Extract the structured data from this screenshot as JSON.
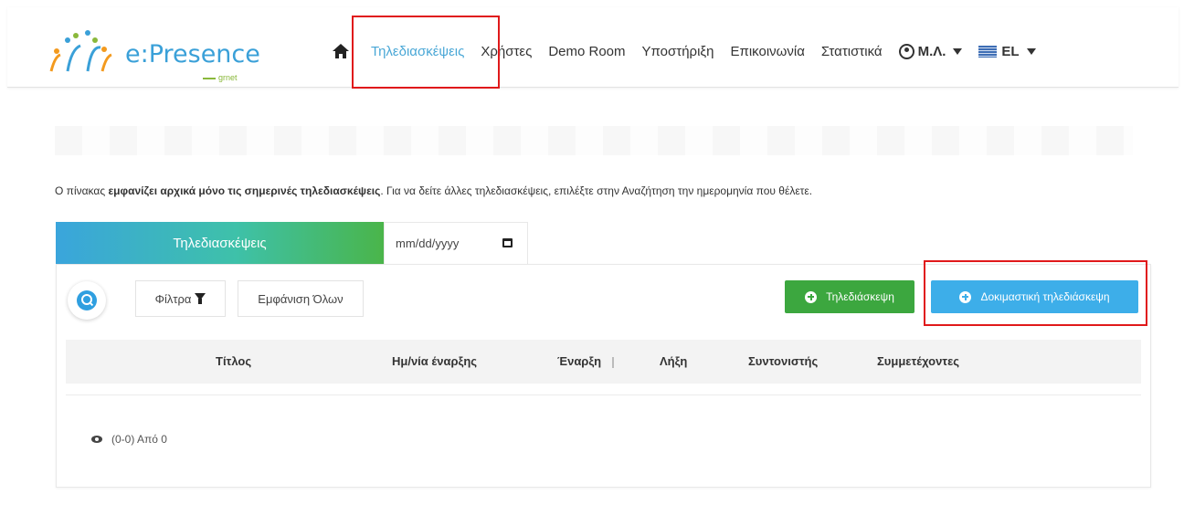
{
  "brand": {
    "name": "e:Presence",
    "sub": "grnet"
  },
  "nav": {
    "items": [
      "Τηλεδιασκέψεις",
      "Χρήστες",
      "Demo Room",
      "Υποστήριξη",
      "Επικοινωνία",
      "Στατιστικά"
    ],
    "user": "Μ.Λ.",
    "lang": "EL"
  },
  "info": {
    "prefix": "Ο πίνακας ",
    "bold": "εμφανίζει αρχικά μόνο τις σημερινές τηλεδιασκέψεις",
    "suffix": ". Για να δείτε άλλες τηλεδιασκέψεις, επιλέξτε στην Αναζήτηση την ημερομηνία που θέλετε."
  },
  "tab": {
    "title": "Τηλεδιασκέψεις"
  },
  "date": {
    "placeholder": "mm/dd/yyyy"
  },
  "toolbar": {
    "filters": "Φίλτρα",
    "show_all": "Εμφάνιση Όλων",
    "new_conference": "Τηλεδιάσκεψη",
    "test_conference": "Δοκιμαστική τηλεδιάσκεψη"
  },
  "table": {
    "columns": [
      "Τίτλος",
      "Ημ/νία έναρξης",
      "Έναρξη",
      "Λήξη",
      "Συντονιστής",
      "Συμμετέχοντες"
    ]
  },
  "pagination": {
    "text": "(0-0) Από 0"
  },
  "colors": {
    "highlight": "#e0191b",
    "green": "#3ca73f",
    "blue": "#3daee9",
    "active_link": "#49a7d6"
  }
}
